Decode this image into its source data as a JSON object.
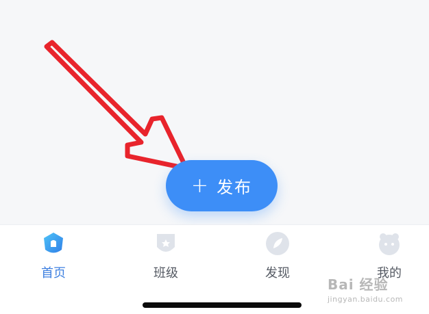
{
  "publish": {
    "plus": "+",
    "label": "发布"
  },
  "tabs": [
    {
      "label": "首页",
      "icon": "home-shield-icon",
      "active": true
    },
    {
      "label": "班级",
      "icon": "class-badge-icon",
      "active": false
    },
    {
      "label": "发现",
      "icon": "discover-leaf-icon",
      "active": false
    },
    {
      "label": "我的",
      "icon": "profile-face-icon",
      "active": false
    }
  ],
  "watermark": {
    "main": "Bai 经验",
    "sub": "jingyan.baidu.com"
  },
  "colors": {
    "accent": "#3d8ef7",
    "active_tab": "#3d7fe0",
    "inactive_tab_text": "#555a63",
    "annotation_arrow": "#e8242c",
    "background": "#f6f7f9"
  }
}
